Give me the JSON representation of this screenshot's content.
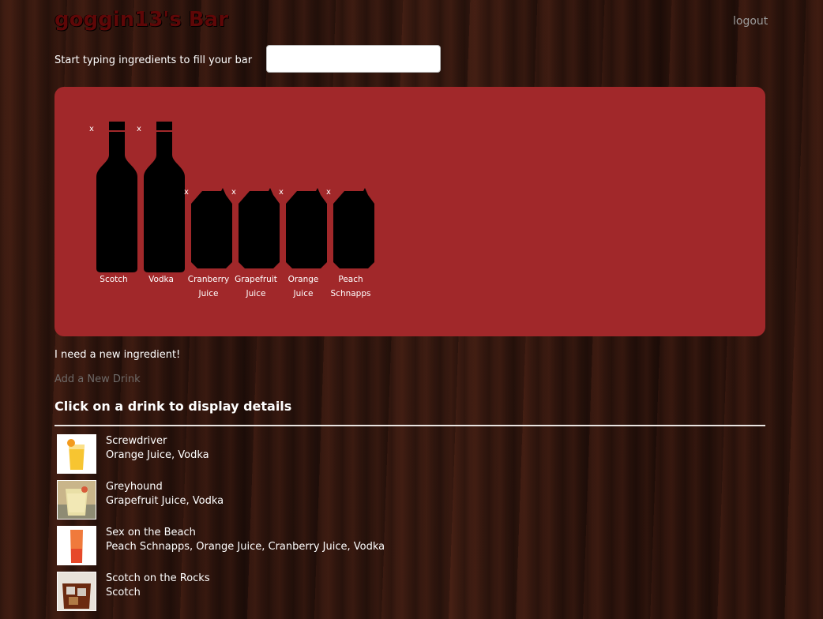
{
  "header": {
    "title": "goggin13's Bar",
    "logout_label": "logout"
  },
  "search": {
    "prompt": "Start typing ingredients to fill your bar",
    "value": "",
    "placeholder": ""
  },
  "bar": {
    "remove_label": "x",
    "ingredients": [
      {
        "name": "Scotch",
        "container": "bottle"
      },
      {
        "name": "Vodka",
        "container": "bottle"
      },
      {
        "name": "Cranberry\nJuice",
        "container": "carton"
      },
      {
        "name": "Grapefruit\nJuice",
        "container": "carton"
      },
      {
        "name": "Orange\nJuice",
        "container": "carton"
      },
      {
        "name": "Peach\nSchnapps",
        "container": "carton"
      }
    ]
  },
  "links": {
    "need_ingredient": "I need a new ingredient!",
    "add_drink": "Add a New Drink"
  },
  "drinks_section": {
    "heading": "Click on a drink to display details",
    "drinks": [
      {
        "name": "Screwdriver",
        "ingredients": "Orange Juice, Vodka",
        "thumb": "screwdriver-glass"
      },
      {
        "name": "Greyhound",
        "ingredients": "Grapefruit Juice, Vodka",
        "thumb": "greyhound-glass"
      },
      {
        "name": "Sex on the Beach",
        "ingredients": "Peach Schnapps, Orange Juice, Cranberry Juice, Vodka",
        "thumb": "highball-glass"
      },
      {
        "name": "Scotch on the Rocks",
        "ingredients": "Scotch",
        "thumb": "rocks-glass"
      }
    ]
  },
  "colors": {
    "panel": "#a1282a",
    "title": "#5e0707",
    "link_muted": "#6e6a68",
    "logout": "#9b9b9b"
  }
}
